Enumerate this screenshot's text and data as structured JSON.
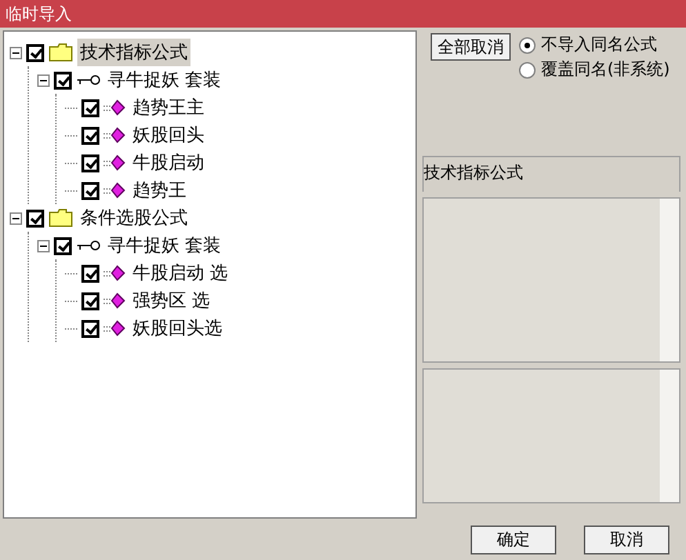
{
  "window": {
    "title": "临时导入"
  },
  "tree": [
    {
      "kind": "folder",
      "label": "技术指标公式",
      "checked": true,
      "expanded": true,
      "selected": true,
      "children": [
        {
          "kind": "key",
          "label": "寻牛捉妖 套装",
          "checked": true,
          "expanded": true,
          "selected": false,
          "children": [
            {
              "kind": "formula",
              "label": "趋势王主",
              "checked": true,
              "selected": false
            },
            {
              "kind": "formula",
              "label": "妖股回头",
              "checked": true,
              "selected": false
            },
            {
              "kind": "formula",
              "label": "牛股启动",
              "checked": true,
              "selected": false
            },
            {
              "kind": "formula",
              "label": "趋势王",
              "checked": true,
              "selected": false
            }
          ]
        }
      ]
    },
    {
      "kind": "folder",
      "label": "条件选股公式",
      "checked": true,
      "expanded": true,
      "selected": false,
      "children": [
        {
          "kind": "key",
          "label": "寻牛捉妖 套装",
          "checked": true,
          "expanded": true,
          "selected": false,
          "children": [
            {
              "kind": "formula",
              "label": "牛股启动 选",
              "checked": true,
              "selected": false
            },
            {
              "kind": "formula",
              "label": "强势区 选",
              "checked": true,
              "selected": false
            },
            {
              "kind": "formula",
              "label": "妖股回头选",
              "checked": true,
              "selected": false
            }
          ]
        }
      ]
    }
  ],
  "toggle_button": "全部取消",
  "options": [
    {
      "label": "不导入同名公式",
      "selected": true
    },
    {
      "label": "覆盖同名(非系统)",
      "selected": false
    }
  ],
  "category_label": "技术指标公式",
  "buttons": [
    "确定",
    "取消"
  ]
}
